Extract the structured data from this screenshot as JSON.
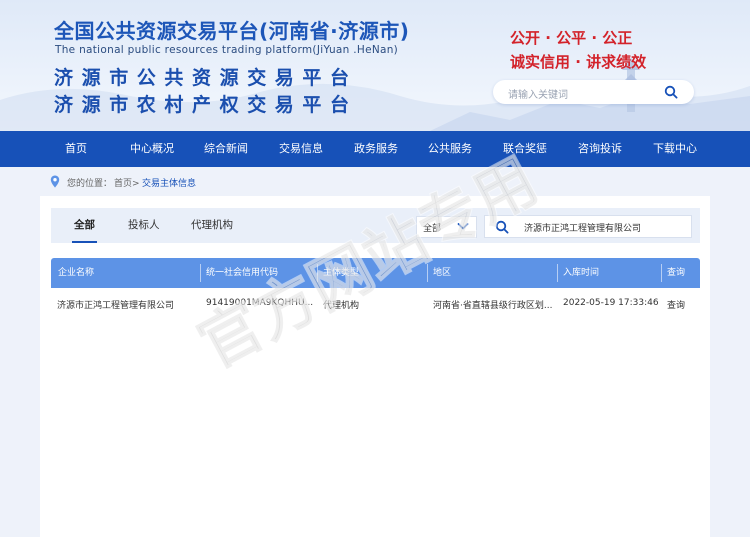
{
  "header": {
    "title_cn": "全国公共资源交易平台(河南省·济源市)",
    "title_en": "The national public resources trading platform(JiYuan .HeNan)",
    "title_line1": "济源市公共资源交易平台",
    "title_line2": "济源市农村产权交易平台",
    "slogan_line1": "公开 · 公平 · 公正",
    "slogan_line2": "诚实信用 · 讲求绩效",
    "search_placeholder": "请输入关键词",
    "search_icon": "search-icon"
  },
  "nav": {
    "items": [
      "首页",
      "中心概况",
      "综合新闻",
      "交易信息",
      "政务服务",
      "公共服务",
      "联合奖惩",
      "咨询投诉",
      "下载中心"
    ]
  },
  "breadcrumb": {
    "location_icon": "location-pin-icon",
    "prefix": "您的位置：",
    "home": "首页>",
    "current": "交易主体信息"
  },
  "filter": {
    "tabs": [
      "全部",
      "投标人",
      "代理机构"
    ],
    "active_tab": "全部",
    "select_value": "全部",
    "search_value": "济源市正鸿工程管理有限公司"
  },
  "table": {
    "headers": [
      "企业名称",
      "统一社会信用代码",
      "主体类型",
      "地区",
      "入库时间",
      "查询"
    ],
    "rows": [
      [
        "济源市正鸿工程管理有限公司",
        "91419001MA9KQHHU...",
        "代理机构",
        "河南省·省直辖县级行政区划...",
        "2022-05-19 17:33:46",
        "查询"
      ]
    ]
  },
  "watermark": "官方网站专用",
  "colors": {
    "nav_bg": "#1751b8",
    "title_blue": "#1d56b8",
    "slogan_red": "#d3222a",
    "table_header": "#5d93e6",
    "page_bg": "#eef2fa"
  }
}
